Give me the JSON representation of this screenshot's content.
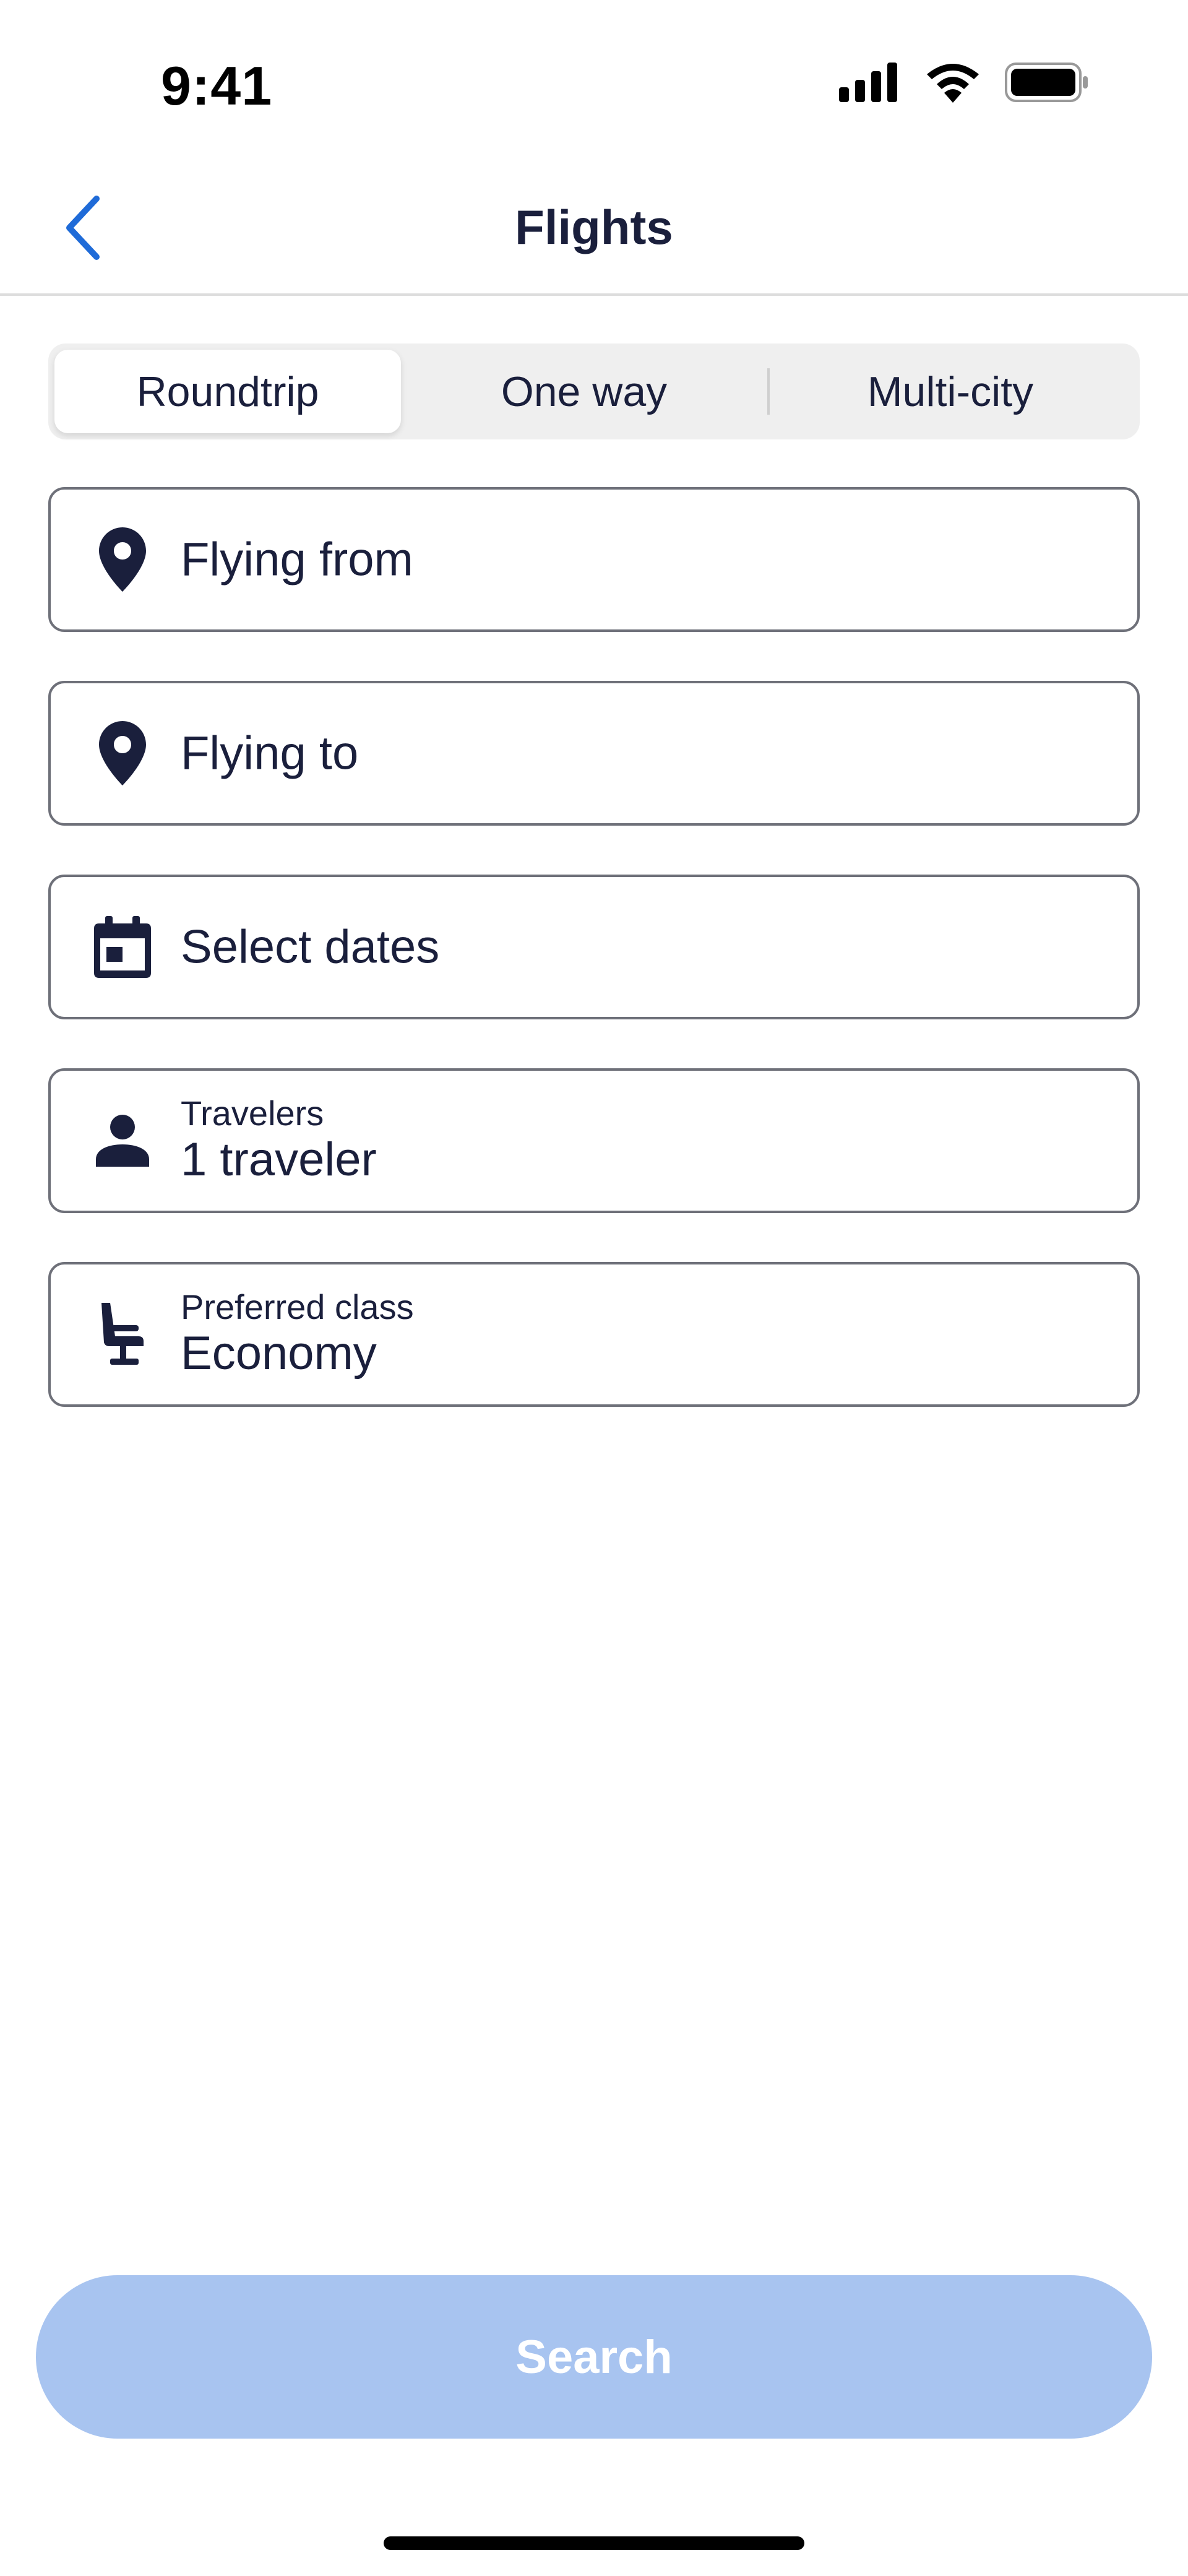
{
  "status_bar": {
    "time": "9:41",
    "icons": [
      "signal-icon",
      "wifi-icon",
      "battery-icon"
    ]
  },
  "nav": {
    "back_icon": "chevron-left-icon",
    "title": "Flights"
  },
  "trip_types": {
    "options": [
      "Roundtrip",
      "One way",
      "Multi-city"
    ],
    "selected": "Roundtrip"
  },
  "form": {
    "origin": {
      "icon": "map-pin-icon",
      "placeholder": "Flying from"
    },
    "destination": {
      "icon": "map-pin-icon",
      "placeholder": "Flying to"
    },
    "dates": {
      "icon": "calendar-icon",
      "placeholder": "Select dates"
    },
    "travelers": {
      "icon": "person-icon",
      "label": "Travelers",
      "value": "1 traveler"
    },
    "cabin_class": {
      "icon": "seat-icon",
      "label": "Preferred class",
      "value": "Economy"
    }
  },
  "search_button": {
    "label": "Search"
  },
  "colors": {
    "primary_text": "#1a1f3c",
    "back_arrow": "#1f6bd8",
    "search_button_disabled": "#a8c4f0",
    "field_border": "#6e7079",
    "segment_bg": "#efefef"
  }
}
